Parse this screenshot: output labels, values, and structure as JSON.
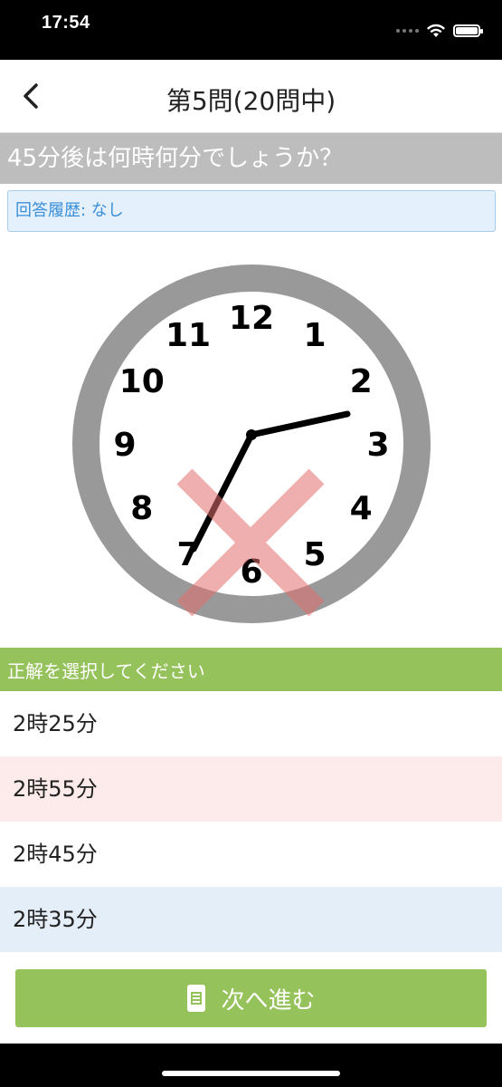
{
  "status": {
    "time": "17:54"
  },
  "nav": {
    "title": "第5問(20問中)"
  },
  "question": {
    "text": "45分後は何時何分でしょうか？"
  },
  "history": {
    "text": "回答履歴: なし"
  },
  "clock": {
    "numbers": [
      "12",
      "1",
      "2",
      "3",
      "4",
      "5",
      "6",
      "7",
      "8",
      "9",
      "10",
      "11"
    ],
    "time_shown": "2:35",
    "incorrect_mark": true,
    "ring_color": "#999999",
    "mark_color": "#e36f6f"
  },
  "select": {
    "header": "正解を選択してください"
  },
  "options": [
    {
      "label": "2時25分"
    },
    {
      "label": "2時55分"
    },
    {
      "label": "2時45分"
    },
    {
      "label": "2時35分"
    }
  ],
  "next": {
    "label": "次へ進む"
  },
  "colors": {
    "accent": "#96c25c",
    "question_bg": "#bdbdbd",
    "history_text": "#3a8fd8"
  }
}
